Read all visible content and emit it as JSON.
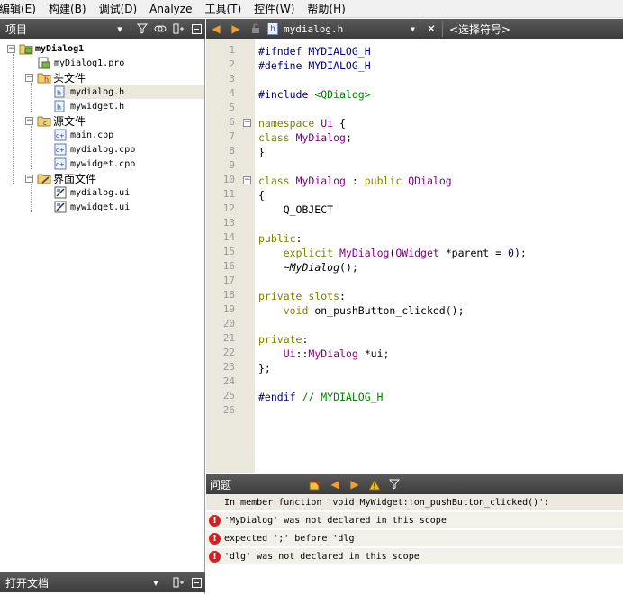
{
  "menubar": {
    "items": [
      "编辑(E)",
      "构建(B)",
      "调试(D)",
      "Analyze",
      "工具(T)",
      "控件(W)",
      "帮助(H)"
    ]
  },
  "project_panel": {
    "title": "项目",
    "tree": [
      {
        "label": "myDialog1",
        "type": "project",
        "level": 0,
        "expanded": true,
        "bold": true
      },
      {
        "label": "myDialog1.pro",
        "type": "pro",
        "level": 1
      },
      {
        "label": "头文件",
        "type": "folder-h",
        "level": 1,
        "expanded": true
      },
      {
        "label": "mydialog.h",
        "type": "h",
        "level": 2,
        "selected": true
      },
      {
        "label": "mywidget.h",
        "type": "h",
        "level": 2
      },
      {
        "label": "源文件",
        "type": "folder-cpp",
        "level": 1,
        "expanded": true
      },
      {
        "label": "main.cpp",
        "type": "cpp",
        "level": 2
      },
      {
        "label": "mydialog.cpp",
        "type": "cpp",
        "level": 2
      },
      {
        "label": "mywidget.cpp",
        "type": "cpp",
        "level": 2
      },
      {
        "label": "界面文件",
        "type": "folder-ui",
        "level": 1,
        "expanded": true
      },
      {
        "label": "mydialog.ui",
        "type": "ui",
        "level": 2
      },
      {
        "label": "mywidget.ui",
        "type": "ui",
        "level": 2
      }
    ]
  },
  "open_docs_panel": {
    "title": "打开文档"
  },
  "editor_toolbar": {
    "file_name": "mydialog.h",
    "symbol_placeholder": "<选择符号>"
  },
  "editor": {
    "lines": [
      {
        "n": "1",
        "html": "<span class='pp'>#ifndef MYDIALOG_H</span>"
      },
      {
        "n": "2",
        "html": "<span class='pp'>#define MYDIALOG_H</span>"
      },
      {
        "n": "3",
        "html": ""
      },
      {
        "n": "4",
        "html": "<span class='pp'>#include </span><span class='str'>&lt;QDialog&gt;</span>"
      },
      {
        "n": "5",
        "html": ""
      },
      {
        "n": "6",
        "html": "<span class='kw'>namespace</span> <span class='ty'>Ui</span> {",
        "fold": true
      },
      {
        "n": "7",
        "html": "<span class='kw'>class</span> <span class='ty'>MyDialog</span>;"
      },
      {
        "n": "8",
        "html": "}"
      },
      {
        "n": "9",
        "html": ""
      },
      {
        "n": "10",
        "html": "<span class='kw'>class</span> <span class='ty'>MyDialog</span> : <span class='kw'>public</span> <span class='ty'>QDialog</span>",
        "fold": true
      },
      {
        "n": "11",
        "html": "{"
      },
      {
        "n": "12",
        "html": "    Q_OBJECT"
      },
      {
        "n": "13",
        "html": ""
      },
      {
        "n": "14",
        "html": "<span class='kw'>public</span>:"
      },
      {
        "n": "15",
        "html": "    <span class='kw'>explicit</span> <span class='ty'>MyDialog</span>(<span class='ty'>QWidget</span> *parent = <span class='num'>0</span>);"
      },
      {
        "n": "16",
        "html": "    ~<span class='it'>MyDialog</span>();"
      },
      {
        "n": "17",
        "html": ""
      },
      {
        "n": "18",
        "html": "<span class='kw'>private</span> <span class='kw'>slots</span>:"
      },
      {
        "n": "19",
        "html": "    <span class='kw'>void</span> on_pushButton_clicked();"
      },
      {
        "n": "20",
        "html": ""
      },
      {
        "n": "21",
        "html": "<span class='kw'>private</span>:"
      },
      {
        "n": "22",
        "html": "    <span class='ty'>Ui</span>::<span class='ty'>MyDialog</span> *ui;"
      },
      {
        "n": "23",
        "html": "};"
      },
      {
        "n": "24",
        "html": ""
      },
      {
        "n": "25",
        "html": "<span class='pp'>#endif </span><span class='cm'>// MYDIALOG_H</span>"
      },
      {
        "n": "26",
        "html": ""
      }
    ]
  },
  "issues_panel": {
    "title": "问题",
    "rows": [
      {
        "kind": "info",
        "text": "In member function 'void MyWidget::on_pushButton_clicked()':"
      },
      {
        "kind": "error",
        "text": "'MyDialog' was not declared in this scope"
      },
      {
        "kind": "error",
        "text": "expected ';' before 'dlg'"
      },
      {
        "kind": "error",
        "text": "'dlg' was not declared in this scope"
      }
    ]
  },
  "colors": {
    "panel_header": "#4a4a4a",
    "gutter": "#eae8dc",
    "error": "#d42020",
    "preprocessor": "#000080",
    "keyword": "#808000",
    "type": "#800080",
    "string": "#008000"
  }
}
